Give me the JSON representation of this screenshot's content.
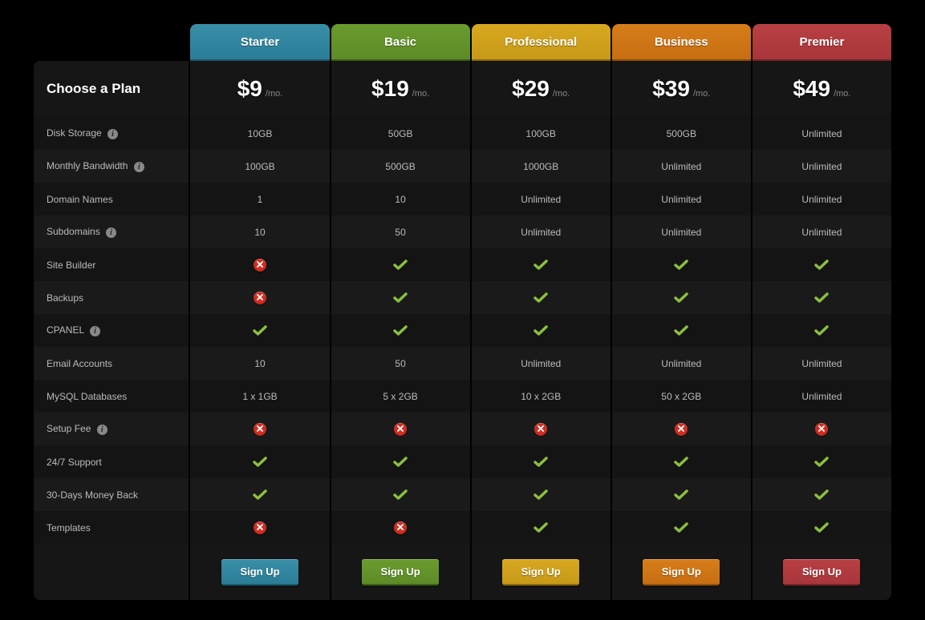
{
  "title": "Choose a Plan",
  "price_suffix": "/mo.",
  "signup_label": "Sign Up",
  "plans": [
    {
      "name": "Starter",
      "price": "$9"
    },
    {
      "name": "Basic",
      "price": "$19"
    },
    {
      "name": "Professional",
      "price": "$29"
    },
    {
      "name": "Business",
      "price": "$39"
    },
    {
      "name": "Premier",
      "price": "$49"
    }
  ],
  "features": [
    {
      "label": "Disk Storage",
      "info": true,
      "values": [
        "10GB",
        "50GB",
        "100GB",
        "500GB",
        "Unlimited"
      ]
    },
    {
      "label": "Monthly Bandwidth",
      "info": true,
      "values": [
        "100GB",
        "500GB",
        "1000GB",
        "Unlimited",
        "Unlimited"
      ]
    },
    {
      "label": "Domain Names",
      "info": false,
      "values": [
        "1",
        "10",
        "Unlimited",
        "Unlimited",
        "Unlimited"
      ]
    },
    {
      "label": "Subdomains",
      "info": true,
      "values": [
        "10",
        "50",
        "Unlimited",
        "Unlimited",
        "Unlimited"
      ]
    },
    {
      "label": "Site Builder",
      "info": false,
      "values": [
        "cross",
        "check",
        "check",
        "check",
        "check"
      ]
    },
    {
      "label": "Backups",
      "info": false,
      "values": [
        "cross",
        "check",
        "check",
        "check",
        "check"
      ]
    },
    {
      "label": "CPANEL",
      "info": true,
      "values": [
        "check",
        "check",
        "check",
        "check",
        "check"
      ]
    },
    {
      "label": "Email Accounts",
      "info": false,
      "values": [
        "10",
        "50",
        "Unlimited",
        "Unlimited",
        "Unlimited"
      ]
    },
    {
      "label": "MySQL Databases",
      "info": false,
      "values": [
        "1 x 1GB",
        "5 x 2GB",
        "10 x 2GB",
        "50 x 2GB",
        "Unlimited"
      ]
    },
    {
      "label": "Setup Fee",
      "info": true,
      "values": [
        "cross",
        "cross",
        "cross",
        "cross",
        "cross"
      ]
    },
    {
      "label": "24/7 Support",
      "info": false,
      "values": [
        "check",
        "check",
        "check",
        "check",
        "check"
      ]
    },
    {
      "label": "30-Days Money Back",
      "info": false,
      "values": [
        "check",
        "check",
        "check",
        "check",
        "check"
      ]
    },
    {
      "label": "Templates",
      "info": false,
      "values": [
        "cross",
        "cross",
        "check",
        "check",
        "check"
      ]
    }
  ]
}
